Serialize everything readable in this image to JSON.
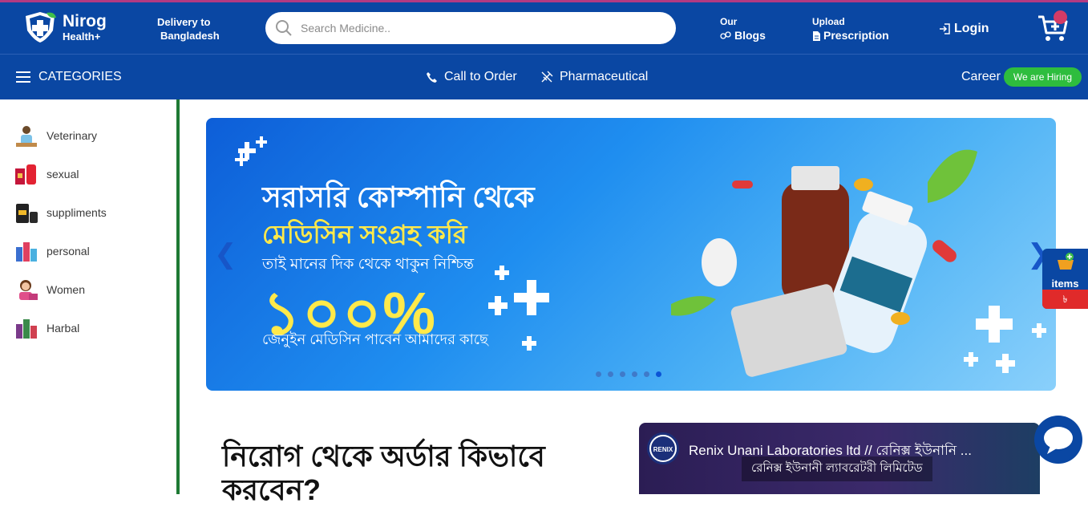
{
  "brand": {
    "name": "Nirog",
    "sub": "Health+"
  },
  "header": {
    "delivery_label": "Delivery to",
    "delivery_value": "Bangladesh",
    "search_placeholder": "Search Medicine..",
    "blogs_top": "Our",
    "blogs_label": "Blogs",
    "upload_top": "Upload",
    "upload_label": "Prescription",
    "login_label": "Login"
  },
  "nav": {
    "categories_label": "CATEGORIES",
    "call_label": "Call to Order",
    "pharma_label": "Pharmaceutical",
    "career_label": "Career",
    "hiring_badge": "We are Hiring"
  },
  "sidebar": {
    "items": [
      {
        "label": "Veterinary"
      },
      {
        "label": "sexual"
      },
      {
        "label": "suppliments"
      },
      {
        "label": "personal"
      },
      {
        "label": "Women"
      },
      {
        "label": "Harbal"
      }
    ]
  },
  "banner": {
    "line1": "সরাসরি কোম্পানি থেকে",
    "line2": "মেডিসিন সংগ্রহ করি",
    "line3": "তাই মানের দিক থেকে থাকুন নিশ্চিন্ত",
    "line4": "১০০%",
    "line5": "জেনুইন মেডিসিন পাবেন আমাদের কাছে",
    "slide_count": 6,
    "active_slide": 6
  },
  "floating_cart": {
    "label": "items",
    "price": "৳"
  },
  "section": {
    "howto_title": "নিরোগ থেকে অর্ডার কিভাবে করবেন?"
  },
  "video": {
    "title": "Renix Unani Laboratories ltd // রেনিক্স ইউনানি ...",
    "subtitle": "রেনিক্স ইউনানী ল্যাবরেটরী লিমিটেড",
    "logo_text": "RENIX"
  },
  "colors": {
    "primary": "#0a47a3",
    "hiring": "#2ebd3e",
    "accent_yellow": "#ffe94a",
    "sidebar_border": "#1e7a34"
  }
}
